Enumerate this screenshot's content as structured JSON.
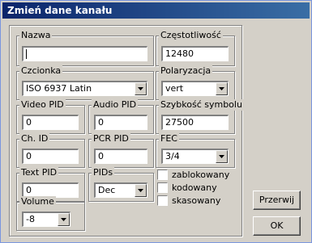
{
  "window": {
    "title": "Zmień dane kanału"
  },
  "fields": {
    "nazwa": {
      "label": "Nazwa",
      "value": ""
    },
    "czestotliwosc": {
      "label": "Częstotliwość",
      "value": "12480"
    },
    "czcionka": {
      "label": "Czcionka",
      "value": "ISO 6937 Latin"
    },
    "polaryzacja": {
      "label": "Polaryzacja",
      "value": "vert"
    },
    "video_pid": {
      "label": "Video PID",
      "value": "0"
    },
    "audio_pid": {
      "label": "Audio PID",
      "value": "0"
    },
    "szybkosc_symbolu": {
      "label": "Szybkość symbolu",
      "value": "27500"
    },
    "ch_id": {
      "label": "Ch. ID",
      "value": "0"
    },
    "pcr_pid": {
      "label": "PCR PID",
      "value": "0"
    },
    "fec": {
      "label": "FEC",
      "value": "3/4"
    },
    "text_pid": {
      "label": "Text PID",
      "value": "0"
    },
    "pids": {
      "label": "PIDs",
      "value": "Dec"
    },
    "volume": {
      "label": "Volume",
      "value": "-8"
    }
  },
  "checkboxes": {
    "zablokowany": {
      "label": "zablokowany",
      "checked": false
    },
    "kodowany": {
      "label": "kodowany",
      "checked": false
    },
    "skasowany": {
      "label": "skasowany",
      "checked": false
    }
  },
  "buttons": {
    "cancel": "Przerwij",
    "ok": "OK"
  }
}
